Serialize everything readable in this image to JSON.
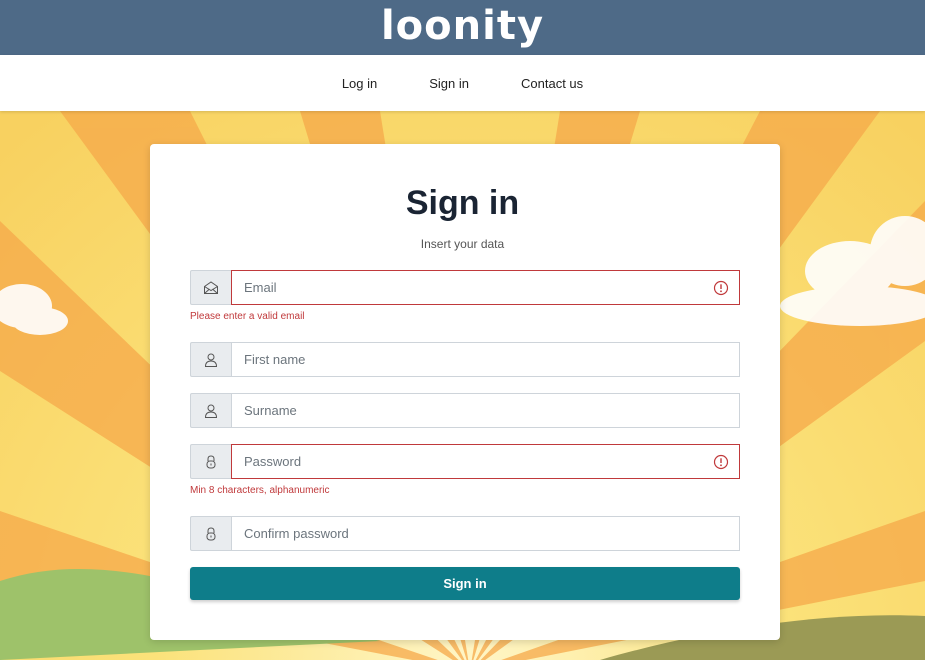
{
  "brand": {
    "logo_text": "loonity"
  },
  "nav": {
    "items": [
      "Log in",
      "Sign in",
      "Contact us"
    ]
  },
  "form": {
    "title": "Sign in",
    "subtitle": "Insert your data",
    "fields": [
      {
        "placeholder": "Email",
        "icon": "envelope-icon",
        "invalid": true,
        "error": "Please enter a valid email"
      },
      {
        "placeholder": "First name",
        "icon": "user-icon",
        "invalid": false
      },
      {
        "placeholder": "Surname",
        "icon": "user-icon",
        "invalid": false
      },
      {
        "placeholder": "Password",
        "icon": "lock-icon",
        "invalid": true,
        "error": "Min 8 characters, alphanumeric"
      },
      {
        "placeholder": "Confirm password",
        "icon": "lock-icon",
        "invalid": false
      }
    ],
    "submit_label": "Sign in"
  },
  "colors": {
    "header": "#4e6a87",
    "accent": "#0e7d8a",
    "error": "#c0393b"
  }
}
